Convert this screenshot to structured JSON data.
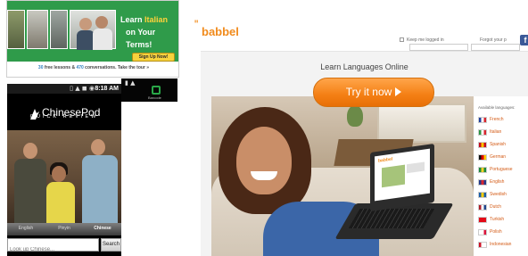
{
  "italian_ad": {
    "headline_line1_prefix": "Learn ",
    "headline_language": "Italian",
    "headline_line2": "on Your Terms!",
    "signup_button": "Sign Up Now!",
    "offer_num1": "30",
    "offer_text1": " free lessons & ",
    "offer_num2": "470",
    "offer_text2": " conversations. Take the tour »"
  },
  "chinesepod": {
    "status_icons": "▯ ▲ ◼ ◉",
    "status_time": "8:18 AM",
    "logo": "ChinesePod",
    "tagline": "QUICK REVIEW",
    "tabs": [
      "English",
      "Pinyin",
      "Chinese"
    ],
    "search_placeholder": "Look up Chinese...",
    "search_button": "Search"
  },
  "android": {
    "status_icons": "▮ ▲",
    "time": "",
    "bag_label": "Barcode"
  },
  "babbel": {
    "logo_mark": "ꞌꞌ",
    "logo": "babbel",
    "keep_logged": "Keep me logged in",
    "forgot": "Forgot your p",
    "email_placeholder": "Email",
    "password_placeholder": "Password",
    "fb_icon": "f",
    "headline": "Learn Languages Online",
    "cta": "Try it now",
    "laptop_logo": "babbel",
    "languages_title": "Available languages:",
    "languages": [
      {
        "name": "French",
        "colors": [
          "#1f3f9e",
          "#ffffff",
          "#d8262f"
        ]
      },
      {
        "name": "Italian",
        "colors": [
          "#2a9443",
          "#ffffff",
          "#d8262f"
        ]
      },
      {
        "name": "Spanish",
        "colors": [
          "#c60b1e",
          "#ffc400",
          "#c60b1e"
        ]
      },
      {
        "name": "German",
        "colors": [
          "#111111",
          "#dd0000",
          "#ffce00"
        ]
      },
      {
        "name": "Portuguese",
        "colors": [
          "#1a8a3c",
          "#f1d02a",
          "#1a8a3c"
        ]
      },
      {
        "name": "English",
        "colors": [
          "#253a8a",
          "#d8262f",
          "#253a8a"
        ]
      },
      {
        "name": "Swedish",
        "colors": [
          "#1c5fa8",
          "#ffcd00",
          "#1c5fa8"
        ]
      },
      {
        "name": "Dutch",
        "colors": [
          "#ae1c28",
          "#ffffff",
          "#21468b"
        ]
      },
      {
        "name": "Turkish",
        "colors": [
          "#e30a17",
          "#e30a17",
          "#e30a17"
        ]
      },
      {
        "name": "Polish",
        "colors": [
          "#ffffff",
          "#ffffff",
          "#dc143c"
        ]
      },
      {
        "name": "Indonesian",
        "colors": [
          "#ce1126",
          "#ffffff",
          "#ffffff"
        ]
      }
    ]
  }
}
